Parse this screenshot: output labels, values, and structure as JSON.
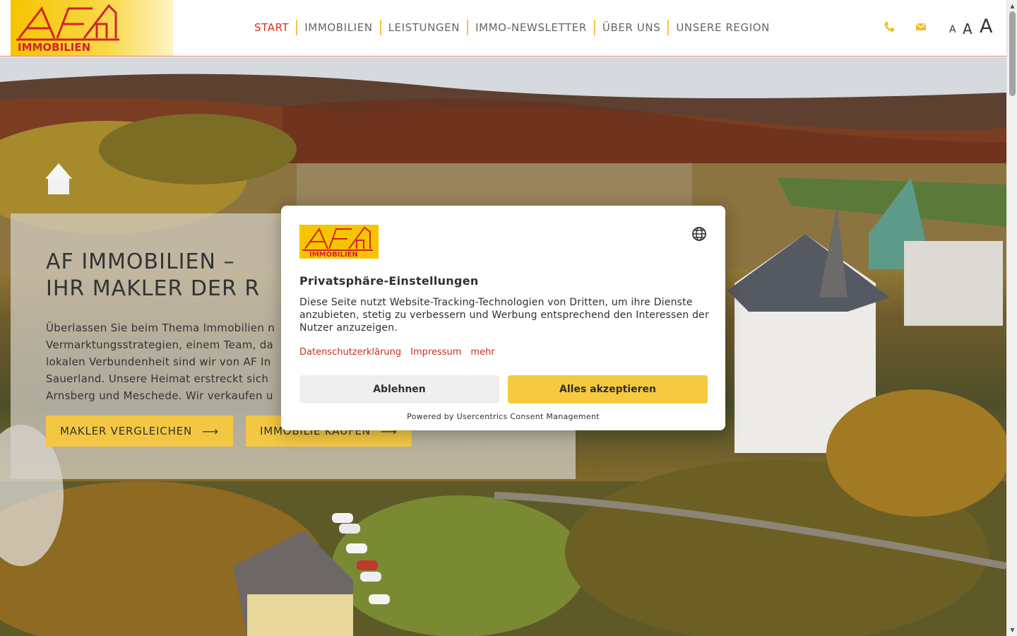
{
  "brand": {
    "logo_text_top": "AF",
    "logo_text_bottom": "IMMOBILIEN"
  },
  "nav": {
    "items": [
      {
        "label": "START",
        "active": true
      },
      {
        "label": "IMMOBILIEN"
      },
      {
        "label": "LEISTUNGEN"
      },
      {
        "label": "IMMO-NEWSLETTER"
      },
      {
        "label": "ÜBER UNS"
      },
      {
        "label": "UNSERE REGION"
      }
    ]
  },
  "header_icons": {
    "phone": "phone-icon",
    "mail": "mail-icon"
  },
  "font_size_controls": [
    "A",
    "A",
    "A"
  ],
  "hero": {
    "title_line1": "AF IMMOBILIEN –",
    "title_line2": "IHR MAKLER DER R",
    "text": "Überlassen Sie beim Thema Immobilien n... Vermarktungsstrategien, einem Team, da... lokalen Verbundenheit sind wir von AF I... Sauerland. Unsere Heimat erstreckt sich ... Arnsberg und Meschede. Wir verkaufen u...",
    "text_lines": [
      "Überlassen Sie beim Thema Immobilien n",
      "Vermarktungsstrategien, einem Team, da",
      "lokalen Verbundenheit sind wir von AF In",
      "Sauerland. Unsere Heimat erstreckt sich",
      "Arnsberg und Meschede. Wir verkaufen u"
    ],
    "button_compare": "MAKLER VERGLEICHEN",
    "button_buy": "IMMOBILIE KAUFEN"
  },
  "consent": {
    "title": "Privatsphäre-Einstellungen",
    "text": "Diese Seite nutzt Website-Tracking-Technologien von Dritten, um ihre Dienste anzubieten, stetig zu verbessern und Werbung entsprechend den Interessen der Nutzer anzuzeigen.",
    "links": [
      "Datenschutzerklärung",
      "Impressum",
      "mehr"
    ],
    "deny_label": "Ablehnen",
    "accept_label": "Alles akzeptieren",
    "powered_by": "Powered by Usercentrics Consent Management"
  },
  "colors": {
    "accent": "#f3c743",
    "active_nav": "#d4361f",
    "link": "#c8301c",
    "logo_red": "#d2232a"
  }
}
